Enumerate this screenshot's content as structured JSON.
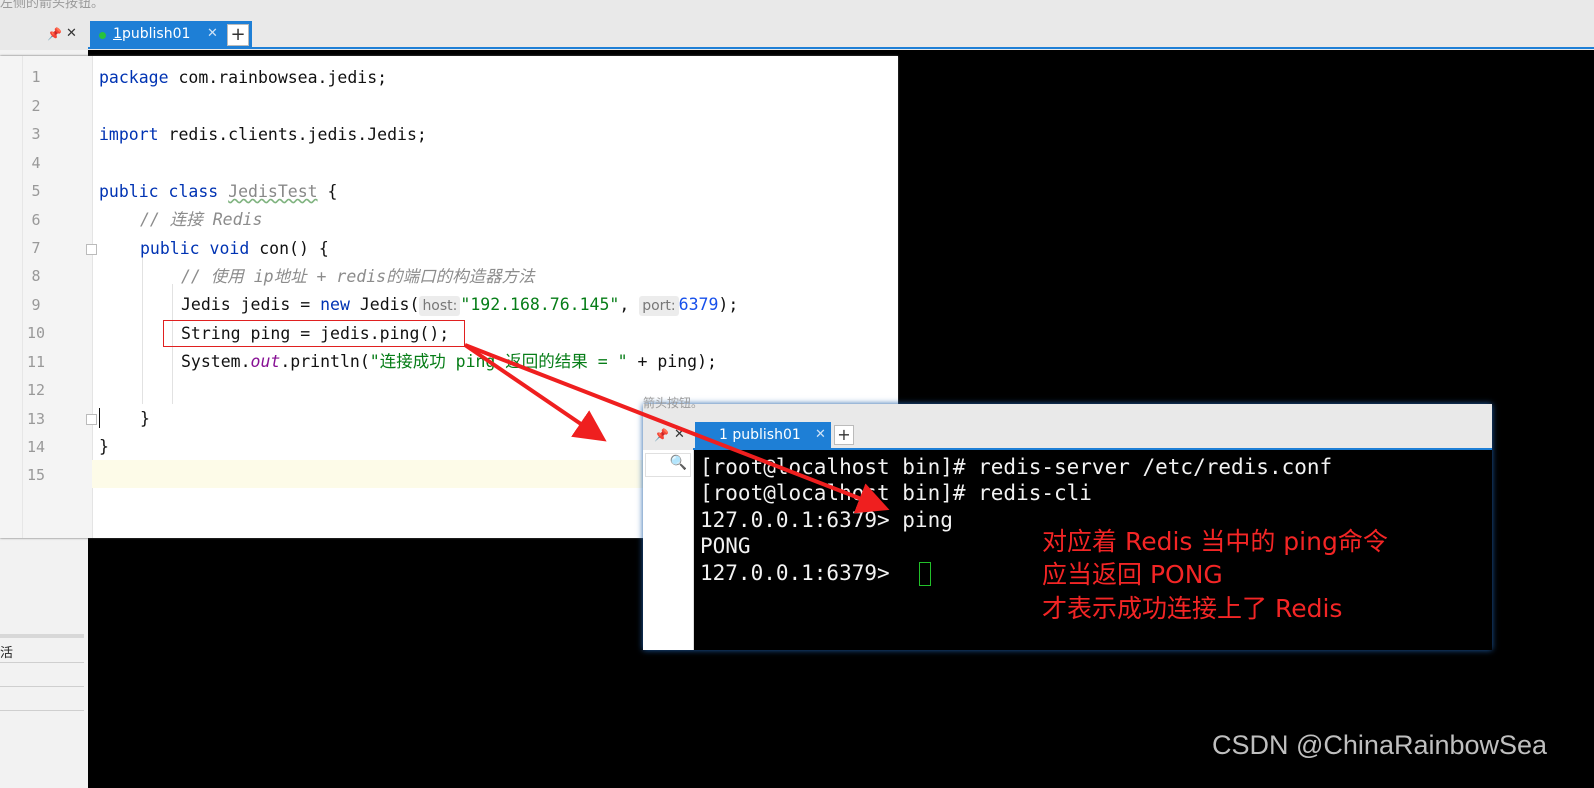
{
  "top_hint": "左侧的箭头按钮。",
  "main_tab": {
    "number": "1",
    "title": " publish01"
  },
  "editor": {
    "line_numbers": [
      "1",
      "2",
      "3",
      "4",
      "5",
      "6",
      "7",
      "8",
      "9",
      "10",
      "11",
      "12",
      "13",
      "14",
      "15"
    ],
    "l1": {
      "kw": "package",
      "rest": " com.rainbowsea.jedis;"
    },
    "l3": {
      "kw": "import",
      "rest": " redis.clients.jedis.Jedis;"
    },
    "l5": {
      "kw": "public class",
      "cls": "JedisTest",
      "rest": " {"
    },
    "l6": {
      "comment": "// 连接 Redis"
    },
    "l7": {
      "kw": "public void",
      "rest": " con() {"
    },
    "l8": {
      "comment": "// 使用 ip地址 + redis的端口的构造器方法"
    },
    "l9": {
      "a": "Jedis jedis = ",
      "kw": "new",
      "b": " Jedis(",
      "hint_host": "host:",
      "host_val": "\"192.168.76.145\"",
      "c": ", ",
      "hint_port": "port:",
      "port_val": "6379",
      "d": ");"
    },
    "l10": {
      "text": "String ping = jedis.ping();"
    },
    "l11": {
      "a": "System.",
      "field": "out",
      "b": ".println(",
      "str": "\"连接成功 ping 返回的结果 = \"",
      "c": " + ping);"
    },
    "l13": {
      "text": "}"
    },
    "l14": {
      "text": "}"
    }
  },
  "left_panel_label": "活",
  "terminal": {
    "hint": "箭头按钮。",
    "tab_title": "1 publish01",
    "lines": [
      "[root@localhost bin]# redis-server /etc/redis.conf",
      "[root@localhost bin]# redis-cli",
      "127.0.0.1:6379> ping",
      "PONG",
      "127.0.0.1:6379> "
    ]
  },
  "annotation": [
    "对应着 Redis 当中的 ping命令",
    "应当返回 PONG",
    "才表示成功连接上了 Redis"
  ],
  "watermark": "CSDN @ChinaRainbowSea",
  "colors": {
    "accent": "#1e7fd6",
    "annotation": "#f32525",
    "terminal_bg": "#000000"
  }
}
